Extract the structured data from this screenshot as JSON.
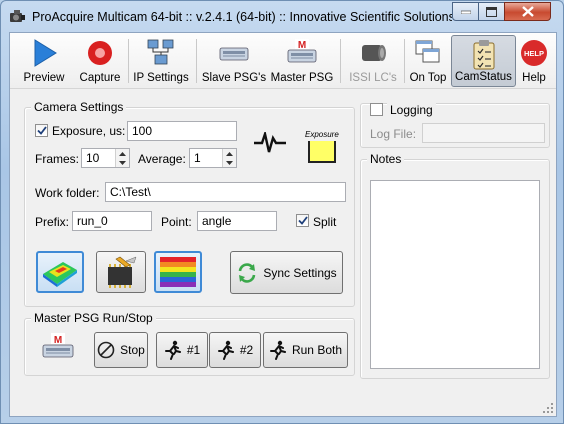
{
  "window": {
    "title": "ProAcquire Multicam 64-bit :: v.2.4.1 (64-bit)  ::  Innovative Scientific Solutions..."
  },
  "toolbar": {
    "items": [
      {
        "label": "Preview",
        "icon": "play-icon"
      },
      {
        "label": "Capture",
        "icon": "record-icon"
      },
      {
        "label": "IP Settings",
        "icon": "network-icon"
      },
      {
        "label": "Slave PSG's",
        "icon": "psg-device-icon"
      },
      {
        "label": "Master PSG",
        "icon": "master-psg-icon"
      },
      {
        "label": "ISSI LC's",
        "icon": "lc-camera-icon",
        "disabled": true
      },
      {
        "label": "On Top",
        "icon": "windows-stack-icon"
      },
      {
        "label": "CamStatus",
        "icon": "clipboard-checklist-icon",
        "pressed": true
      },
      {
        "label": "Help",
        "icon": "help-icon",
        "badge": "HELP"
      }
    ]
  },
  "camera_settings": {
    "legend": "Camera Settings",
    "exposure_label": "Exposure, us:",
    "exposure_checked": true,
    "exposure_value": "100",
    "frames_label": "Frames:",
    "frames_value": "10",
    "average_label": "Average:",
    "average_value": "1",
    "exposure_indicator_label": "Exposure",
    "exposure_indicator_color": "#ffff66",
    "work_folder_label": "Work folder:",
    "work_folder_value": "C:\\Test\\",
    "prefix_label": "Prefix:",
    "prefix_value": "run_0",
    "point_label": "Point:",
    "point_value": "angle",
    "split_label": "Split",
    "split_checked": true,
    "sync_button_label": "Sync Settings"
  },
  "master_psg": {
    "legend": "Master PSG Run/Stop",
    "stop_label": "Stop",
    "run1_label": "#1",
    "run2_label": "#2",
    "run_both_label": "Run Both"
  },
  "logging": {
    "label": "Logging",
    "checked": false,
    "log_file_label": "Log File:",
    "log_file_value": ""
  },
  "notes": {
    "legend": "Notes",
    "value": ""
  },
  "colors": {
    "accent": "#3f8ad6",
    "preview_blue": "#2a7fd8",
    "capture_red": "#d92020"
  }
}
